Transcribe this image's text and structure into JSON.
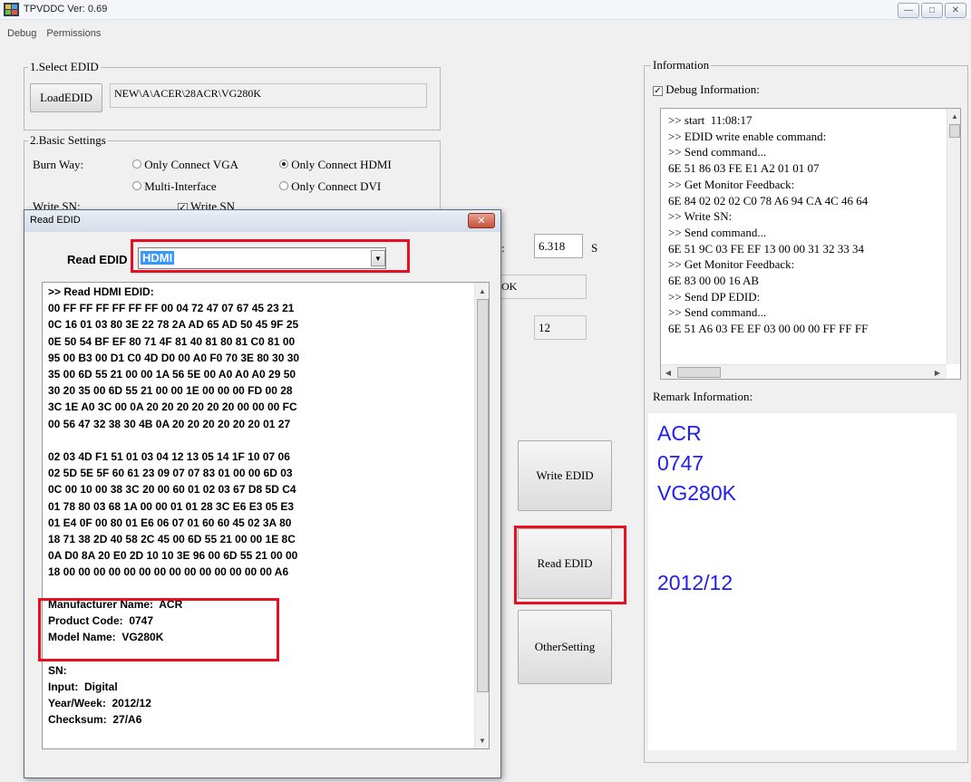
{
  "window": {
    "title": "TPVDDC  Ver: 0.69",
    "minimize": "—",
    "maximize": "□",
    "close": "✕"
  },
  "menu": [
    "Debug",
    "Permissions"
  ],
  "select_edid": {
    "group_title": "1.Select EDID",
    "load_button": "LoadEDID",
    "path": "NEW\\A\\ACER\\28ACR\\VG280K"
  },
  "basic_settings": {
    "group_title": "2.Basic Settings",
    "burn_way_label": "Burn Way:",
    "options": [
      "Only Connect VGA",
      "Only Connect HDMI",
      "Multi-Interface",
      "Only Connect DVI"
    ],
    "selected": "Only Connect HDMI",
    "write_sn_label": "Write SN:",
    "write_sn_checkbox": "Write SN"
  },
  "background_fields": {
    "time_label": ":",
    "time_value": "6.318",
    "time_unit": "S",
    "status_value": "OK",
    "week_value": "12"
  },
  "buttons": {
    "write_edid": "Write EDID",
    "read_edid": "Read EDID",
    "other_setting": "OtherSetting"
  },
  "information": {
    "group_title": "Information",
    "debug_checkbox": "Debug Information:",
    "debug_checked": true,
    "log": [
      ">> start  11:08:17",
      ">> EDID write enable command:",
      ">> Send command...",
      "6E 51 86 03 FE E1 A2 01 01 07",
      ">> Get Monitor Feedback:",
      "6E 84 02 02 02 C0 78 A6 94 CA 4C 46 64",
      ">> Write SN:",
      ">> Send command...",
      "6E 51 9C 03 FE EF 13 00 00 31 32 33 34",
      ">> Get Monitor Feedback:",
      "6E 83 00 00 16 AB",
      ">> Send DP EDID:",
      ">> Send command...",
      "6E 51 A6 03 FE EF 03 00 00 00 FF FF FF"
    ],
    "remark_label": "Remark Information:",
    "remark": [
      "ACR",
      "0747",
      "VG280K",
      "",
      "",
      "2012/12"
    ]
  },
  "dialog": {
    "title": "Read EDID",
    "read_label": "Read EDID",
    "selected_port": "HDMI",
    "edid_lines": [
      ">> Read HDMI EDID:",
      "00 FF FF FF FF FF FF 00 04 72 47 07 67 45 23 21",
      "0C 16 01 03 80 3E 22 78 2A AD 65 AD 50 45 9F 25",
      "0E 50 54 BF EF 80 71 4F 81 40 81 80 81 C0 81 00",
      "95 00 B3 00 D1 C0 4D D0 00 A0 F0 70 3E 80 30 30",
      "35 00 6D 55 21 00 00 1A 56 5E 00 A0 A0 A0 29 50",
      "30 20 35 00 6D 55 21 00 00 1E 00 00 00 FD 00 28",
      "3C 1E A0 3C 00 0A 20 20 20 20 20 20 00 00 00 FC",
      "00 56 47 32 38 30 4B 0A 20 20 20 20 20 20 01 27",
      "",
      "02 03 4D F1 51 01 03 04 12 13 05 14 1F 10 07 06",
      "02 5D 5E 5F 60 61 23 09 07 07 83 01 00 00 6D 03",
      "0C 00 10 00 38 3C 20 00 60 01 02 03 67 D8 5D C4",
      "01 78 80 03 68 1A 00 00 01 01 28 3C E6 E3 05 E3",
      "01 E4 0F 00 80 01 E6 06 07 01 60 60 45 02 3A 80",
      "18 71 38 2D 40 58 2C 45 00 6D 55 21 00 00 1E 8C",
      "0A D0 8A 20 E0 2D 10 10 3E 96 00 6D 55 21 00 00",
      "18 00 00 00 00 00 00 00 00 00 00 00 00 00 00 A6"
    ],
    "info_lines": [
      "Manufacturer Name:  ACR",
      "Product Code:  0747",
      "Model Name:  VG280K",
      "",
      "SN:",
      "Input:  Digital",
      "Year/Week:  2012/12",
      "Checksum:  27/A6"
    ]
  },
  "colors": {
    "highlight_box": "#e8101e",
    "remark_text": "#2020ee",
    "selection": "#3399ff"
  }
}
